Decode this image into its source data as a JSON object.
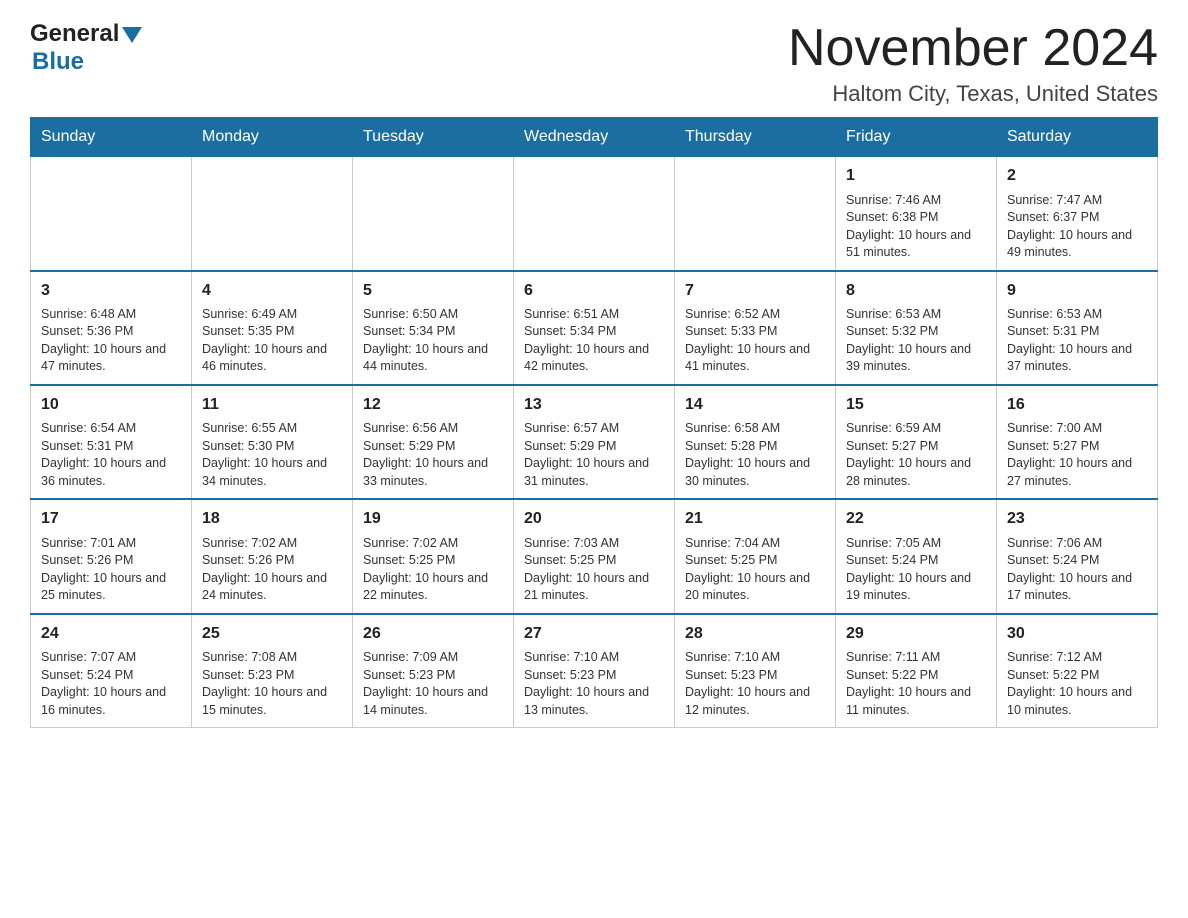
{
  "header": {
    "logo_general": "General",
    "logo_blue": "Blue",
    "month_title": "November 2024",
    "location": "Haltom City, Texas, United States"
  },
  "days_of_week": [
    "Sunday",
    "Monday",
    "Tuesday",
    "Wednesday",
    "Thursday",
    "Friday",
    "Saturday"
  ],
  "weeks": [
    [
      {
        "day": "",
        "info": ""
      },
      {
        "day": "",
        "info": ""
      },
      {
        "day": "",
        "info": ""
      },
      {
        "day": "",
        "info": ""
      },
      {
        "day": "",
        "info": ""
      },
      {
        "day": "1",
        "info": "Sunrise: 7:46 AM\nSunset: 6:38 PM\nDaylight: 10 hours and 51 minutes."
      },
      {
        "day": "2",
        "info": "Sunrise: 7:47 AM\nSunset: 6:37 PM\nDaylight: 10 hours and 49 minutes."
      }
    ],
    [
      {
        "day": "3",
        "info": "Sunrise: 6:48 AM\nSunset: 5:36 PM\nDaylight: 10 hours and 47 minutes."
      },
      {
        "day": "4",
        "info": "Sunrise: 6:49 AM\nSunset: 5:35 PM\nDaylight: 10 hours and 46 minutes."
      },
      {
        "day": "5",
        "info": "Sunrise: 6:50 AM\nSunset: 5:34 PM\nDaylight: 10 hours and 44 minutes."
      },
      {
        "day": "6",
        "info": "Sunrise: 6:51 AM\nSunset: 5:34 PM\nDaylight: 10 hours and 42 minutes."
      },
      {
        "day": "7",
        "info": "Sunrise: 6:52 AM\nSunset: 5:33 PM\nDaylight: 10 hours and 41 minutes."
      },
      {
        "day": "8",
        "info": "Sunrise: 6:53 AM\nSunset: 5:32 PM\nDaylight: 10 hours and 39 minutes."
      },
      {
        "day": "9",
        "info": "Sunrise: 6:53 AM\nSunset: 5:31 PM\nDaylight: 10 hours and 37 minutes."
      }
    ],
    [
      {
        "day": "10",
        "info": "Sunrise: 6:54 AM\nSunset: 5:31 PM\nDaylight: 10 hours and 36 minutes."
      },
      {
        "day": "11",
        "info": "Sunrise: 6:55 AM\nSunset: 5:30 PM\nDaylight: 10 hours and 34 minutes."
      },
      {
        "day": "12",
        "info": "Sunrise: 6:56 AM\nSunset: 5:29 PM\nDaylight: 10 hours and 33 minutes."
      },
      {
        "day": "13",
        "info": "Sunrise: 6:57 AM\nSunset: 5:29 PM\nDaylight: 10 hours and 31 minutes."
      },
      {
        "day": "14",
        "info": "Sunrise: 6:58 AM\nSunset: 5:28 PM\nDaylight: 10 hours and 30 minutes."
      },
      {
        "day": "15",
        "info": "Sunrise: 6:59 AM\nSunset: 5:27 PM\nDaylight: 10 hours and 28 minutes."
      },
      {
        "day": "16",
        "info": "Sunrise: 7:00 AM\nSunset: 5:27 PM\nDaylight: 10 hours and 27 minutes."
      }
    ],
    [
      {
        "day": "17",
        "info": "Sunrise: 7:01 AM\nSunset: 5:26 PM\nDaylight: 10 hours and 25 minutes."
      },
      {
        "day": "18",
        "info": "Sunrise: 7:02 AM\nSunset: 5:26 PM\nDaylight: 10 hours and 24 minutes."
      },
      {
        "day": "19",
        "info": "Sunrise: 7:02 AM\nSunset: 5:25 PM\nDaylight: 10 hours and 22 minutes."
      },
      {
        "day": "20",
        "info": "Sunrise: 7:03 AM\nSunset: 5:25 PM\nDaylight: 10 hours and 21 minutes."
      },
      {
        "day": "21",
        "info": "Sunrise: 7:04 AM\nSunset: 5:25 PM\nDaylight: 10 hours and 20 minutes."
      },
      {
        "day": "22",
        "info": "Sunrise: 7:05 AM\nSunset: 5:24 PM\nDaylight: 10 hours and 19 minutes."
      },
      {
        "day": "23",
        "info": "Sunrise: 7:06 AM\nSunset: 5:24 PM\nDaylight: 10 hours and 17 minutes."
      }
    ],
    [
      {
        "day": "24",
        "info": "Sunrise: 7:07 AM\nSunset: 5:24 PM\nDaylight: 10 hours and 16 minutes."
      },
      {
        "day": "25",
        "info": "Sunrise: 7:08 AM\nSunset: 5:23 PM\nDaylight: 10 hours and 15 minutes."
      },
      {
        "day": "26",
        "info": "Sunrise: 7:09 AM\nSunset: 5:23 PM\nDaylight: 10 hours and 14 minutes."
      },
      {
        "day": "27",
        "info": "Sunrise: 7:10 AM\nSunset: 5:23 PM\nDaylight: 10 hours and 13 minutes."
      },
      {
        "day": "28",
        "info": "Sunrise: 7:10 AM\nSunset: 5:23 PM\nDaylight: 10 hours and 12 minutes."
      },
      {
        "day": "29",
        "info": "Sunrise: 7:11 AM\nSunset: 5:22 PM\nDaylight: 10 hours and 11 minutes."
      },
      {
        "day": "30",
        "info": "Sunrise: 7:12 AM\nSunset: 5:22 PM\nDaylight: 10 hours and 10 minutes."
      }
    ]
  ]
}
